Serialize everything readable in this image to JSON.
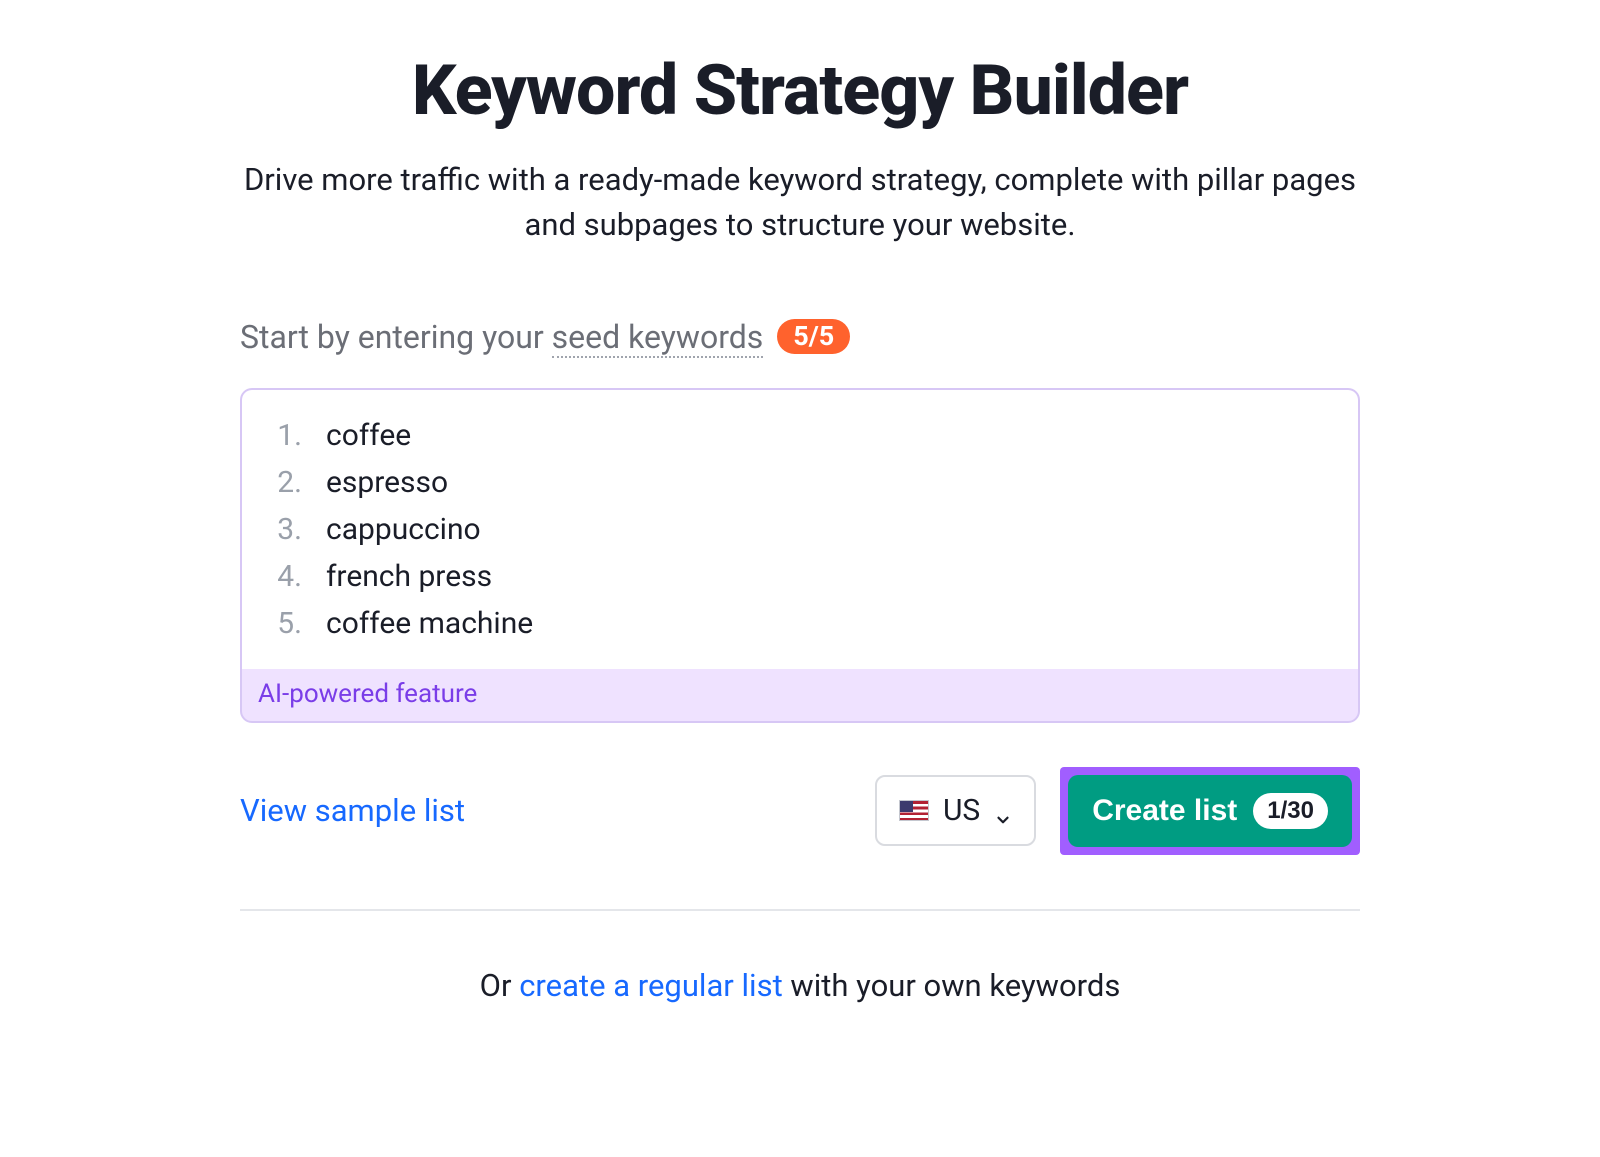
{
  "header": {
    "title": "Keyword Strategy Builder",
    "subtitle": "Drive more traffic with a ready-made keyword strategy, complete with pillar pages and subpages to structure your website."
  },
  "prompt": {
    "prefix": "Start by entering your ",
    "seed_label": "seed keywords",
    "count_badge": "5/5"
  },
  "keywords": [
    {
      "n": "1.",
      "text": "coffee"
    },
    {
      "n": "2.",
      "text": "espresso"
    },
    {
      "n": "3.",
      "text": "cappuccino"
    },
    {
      "n": "4.",
      "text": "french press"
    },
    {
      "n": "5.",
      "text": "coffee machine"
    }
  ],
  "ai_footer": "AI-powered feature",
  "actions": {
    "sample_link": "View sample list",
    "country": "US",
    "create_label": "Create list",
    "quota": "1/30"
  },
  "alt": {
    "prefix": "Or ",
    "link": "create a regular list",
    "suffix": " with your own keywords"
  }
}
